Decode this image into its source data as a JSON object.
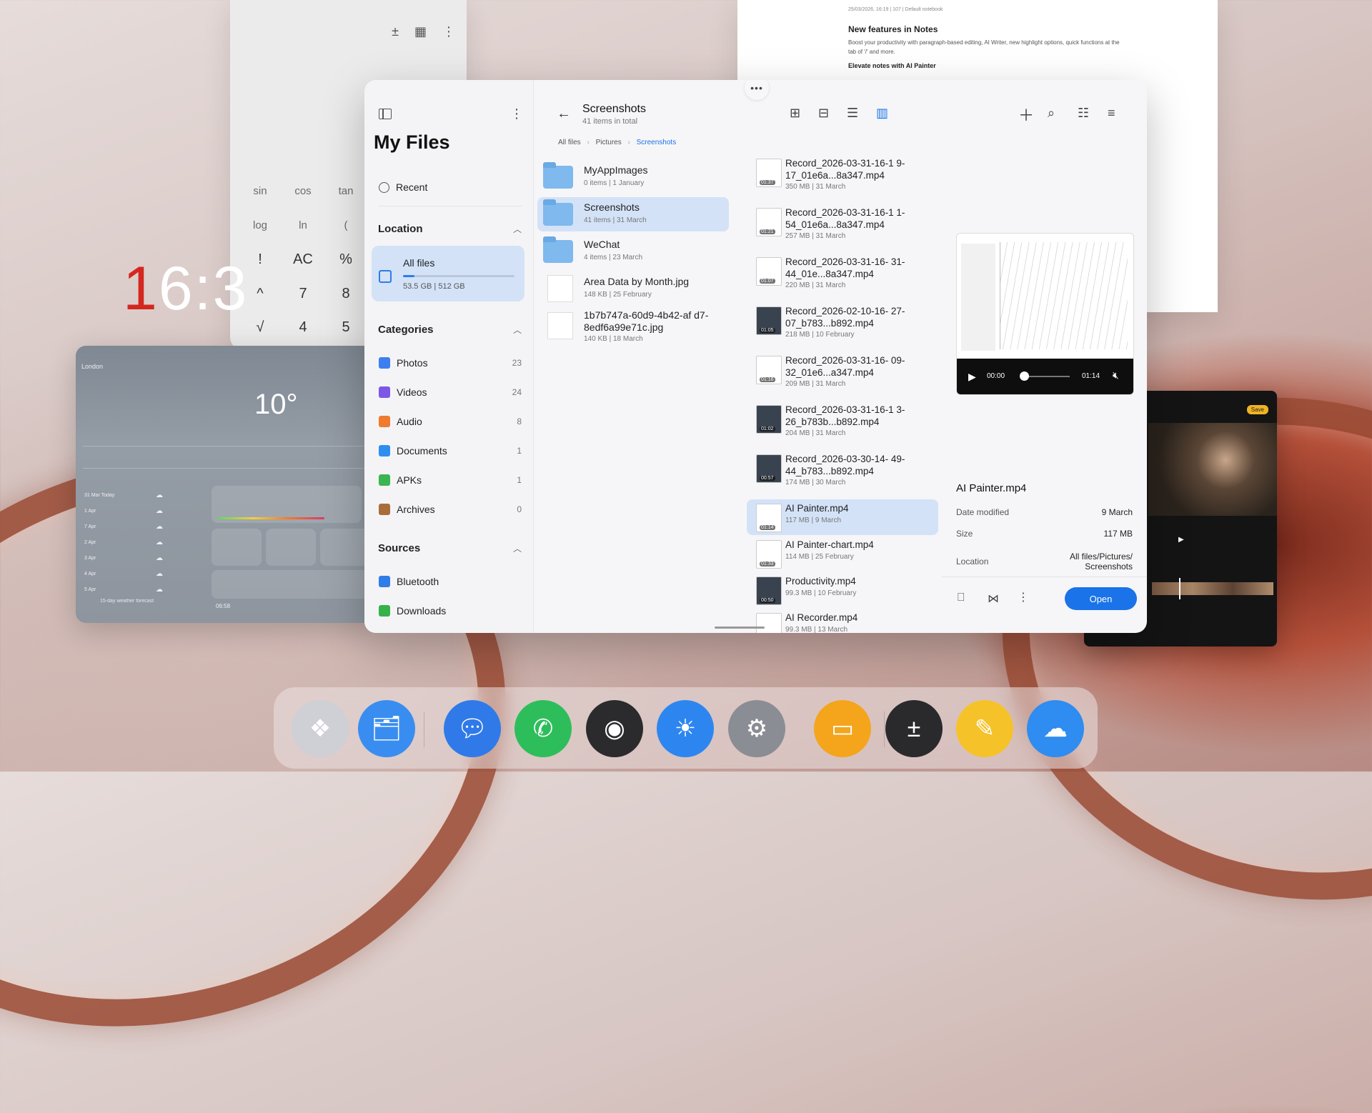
{
  "clock": {
    "h1": "1",
    "rest": "6:3"
  },
  "calculator": {
    "keys": [
      "sin",
      "cos",
      "tan",
      "log",
      "ln",
      "(",
      "!",
      "AC",
      "%",
      "^",
      "7",
      "8",
      "√",
      "4",
      "5"
    ]
  },
  "weather": {
    "city": "London",
    "temperature": "10°",
    "days": [
      "31 Mar Today",
      "1 Apr",
      "7 Apr",
      "2 Apr",
      "3 Apr",
      "4 Apr",
      "5 Apr"
    ],
    "bottom_time": "06:58",
    "bottom_label": "15-day weather forecast"
  },
  "notes": {
    "meta": "25/03/2026, 16:19 | 107 | Default notebook",
    "heading": "New features in Notes",
    "body": "Boost your productivity with paragraph-based editing, AI Writer, new highlight options, quick functions at the tab of '/' and more.",
    "subheading": "Elevate notes with AI Painter"
  },
  "editor": {
    "badge": "Save"
  },
  "sidebar": {
    "title": "My Files",
    "recent": "Recent",
    "location_header": "Location",
    "all_files": {
      "label": "All files",
      "usage": "53.5 GB",
      "total": "512 GB",
      "fill": 0.104
    },
    "categories_header": "Categories",
    "categories": [
      {
        "label": "Photos",
        "count": "23",
        "color": "#3d7ff0"
      },
      {
        "label": "Videos",
        "count": "24",
        "color": "#7b58e6"
      },
      {
        "label": "Audio",
        "count": "8",
        "color": "#f07b2e"
      },
      {
        "label": "Documents",
        "count": "1",
        "color": "#2e8ef0"
      },
      {
        "label": "APKs",
        "count": "1",
        "color": "#3cb44f"
      },
      {
        "label": "Archives",
        "count": "0",
        "color": "#a86d3b"
      }
    ],
    "sources_header": "Sources",
    "sources": [
      {
        "label": "Bluetooth",
        "color": "#2f7de8"
      },
      {
        "label": "Downloads",
        "color": "#36b24a"
      }
    ]
  },
  "header": {
    "title": "Screenshots",
    "subtitle": "41 items in total",
    "breadcrumb": [
      "All files",
      "Pictures",
      "Screenshots"
    ]
  },
  "folders": [
    {
      "name": "MyAppImages",
      "meta": "0 items",
      "date": "1 January",
      "type": "folder"
    },
    {
      "name": "Screenshots",
      "meta": "41 items",
      "date": "31 March",
      "type": "folder"
    },
    {
      "name": "WeChat",
      "meta": "4 items",
      "date": "23 March",
      "type": "folder"
    },
    {
      "name": "Area Data by Month.jpg",
      "meta": "148 KB",
      "date": "25 February",
      "type": "image"
    },
    {
      "name": "1b7b747a-60d9-4b42-af d7-8edf6a99e71c.jpg",
      "meta": "140 KB",
      "date": "18 March",
      "type": "image"
    }
  ],
  "videos": [
    {
      "name": "Record_2026-03-31-16-1 9-17_01e6a...8a347.mp4",
      "size": "350 MB",
      "date": "31 March",
      "dur": "01:37"
    },
    {
      "name": "Record_2026-03-31-16-1 1-54_01e6a...8a347.mp4",
      "size": "257 MB",
      "date": "31 March",
      "dur": "01:21"
    },
    {
      "name": "Record_2026-03-31-16- 31-44_01e...8a347.mp4",
      "size": "220 MB",
      "date": "31 March",
      "dur": "01:07"
    },
    {
      "name": "Record_2026-02-10-16- 27-07_b783...b892.mp4",
      "size": "218 MB",
      "date": "10 February",
      "dur": "01:05"
    },
    {
      "name": "Record_2026-03-31-16- 09-32_01e6...a347.mp4",
      "size": "209 MB",
      "date": "31 March",
      "dur": "01:16"
    },
    {
      "name": "Record_2026-03-31-16-1 3-26_b783b...b892.mp4",
      "size": "204 MB",
      "date": "31 March",
      "dur": "01:02"
    },
    {
      "name": "Record_2026-03-30-14- 49-44_b783...b892.mp4",
      "size": "174 MB",
      "date": "30 March",
      "dur": "00:57"
    },
    {
      "name": "AI Painter.mp4",
      "size": "117 MB",
      "date": "9 March",
      "dur": "01:14"
    },
    {
      "name": "AI Painter-chart.mp4",
      "size": "114 MB",
      "date": "25 February",
      "dur": "01:33"
    },
    {
      "name": "Productivity.mp4",
      "size": "99.3 MB",
      "date": "10 February",
      "dur": "00:50"
    },
    {
      "name": "AI Recorder.mp4",
      "size": "99.3 MB",
      "date": "13 March",
      "dur": "02:22"
    }
  ],
  "preview": {
    "filename": "AI Painter.mp4",
    "time_current": "00:00",
    "time_total": "01:14",
    "labels": {
      "modified": "Date modified",
      "size": "Size",
      "location": "Location"
    },
    "modified": "9 March",
    "size": "117 MB",
    "location_line1": "All files/Pictures/",
    "location_line2": "Screenshots",
    "open_label": "Open"
  },
  "dock": [
    {
      "name": "app-drawer-icon",
      "color": "#cfcfd6"
    },
    {
      "name": "files-recent-icon",
      "color": "#3a8df0"
    },
    {
      "name": "messages-icon",
      "color": "#2f7ae8"
    },
    {
      "name": "phone-icon",
      "color": "#2dbe5b"
    },
    {
      "name": "camera-icon",
      "color": "#2b2b2e"
    },
    {
      "name": "weather-icon",
      "color": "#2d86f0"
    },
    {
      "name": "settings-icon",
      "color": "#8a8d93"
    },
    {
      "name": "my-files-icon",
      "color": "#f4a51c"
    },
    {
      "name": "calculator-icon",
      "color": "#2a2a2d"
    },
    {
      "name": "notes-icon",
      "color": "#f6c22a"
    },
    {
      "name": "cloud-icon",
      "color": "#2f8cf0"
    }
  ]
}
